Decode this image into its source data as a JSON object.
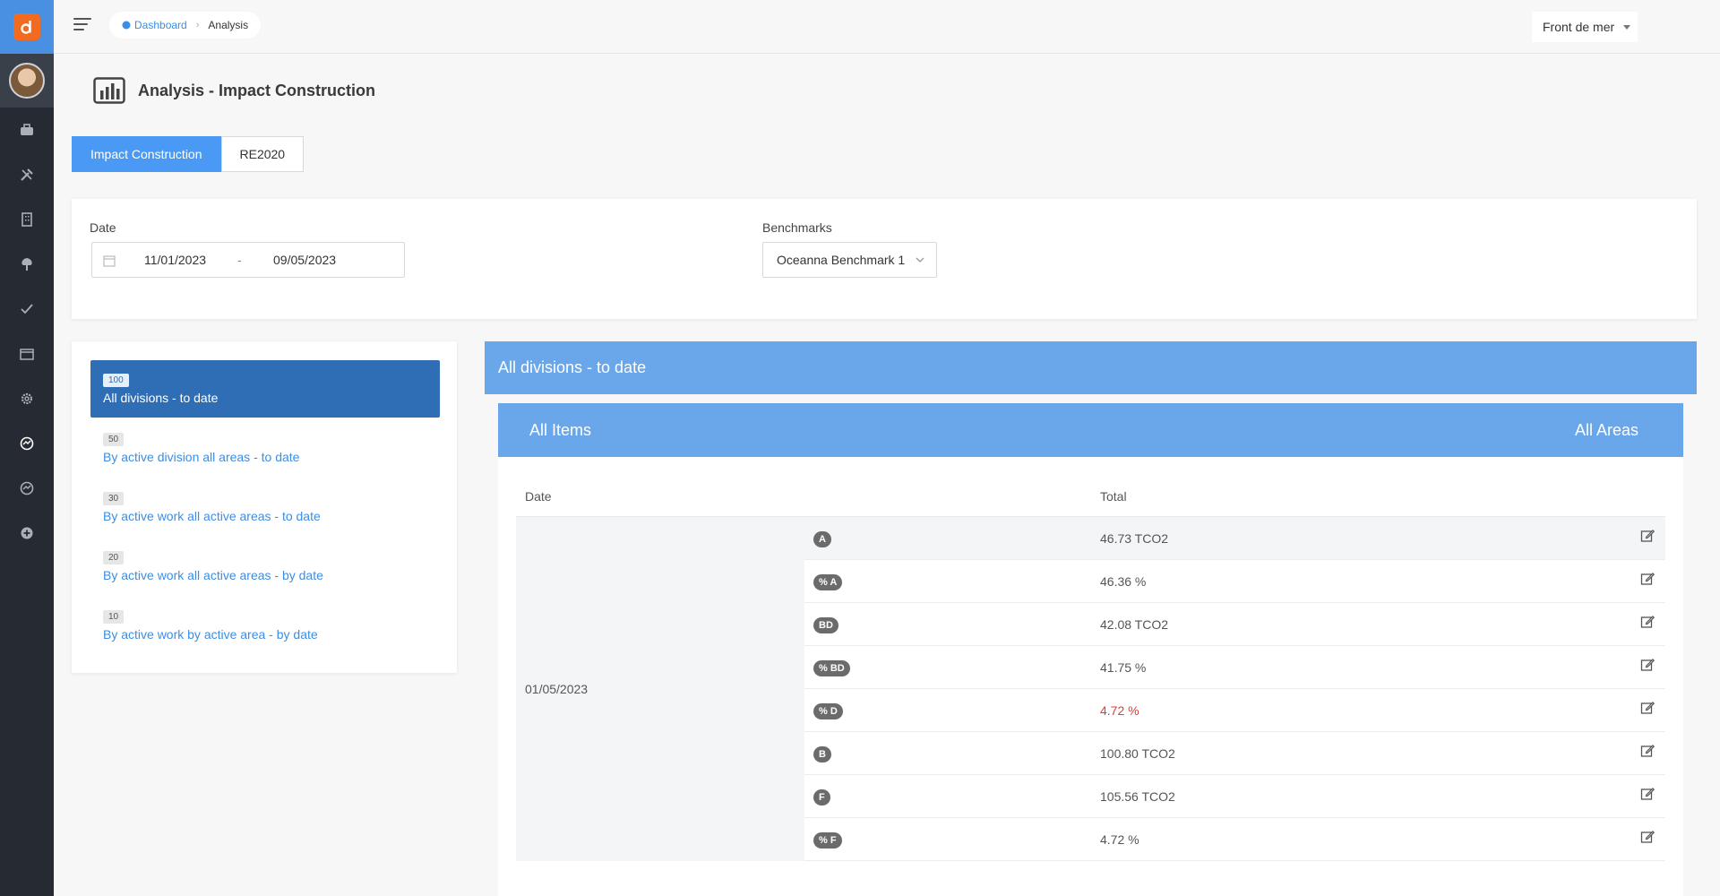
{
  "breadcrumb": {
    "home": "Dashboard",
    "current": "Analysis"
  },
  "site_select": {
    "value": "Front de mer"
  },
  "page": {
    "title": "Analysis - Impact Construction"
  },
  "tabs": [
    {
      "label": "Impact Construction",
      "active": true
    },
    {
      "label": "RE2020",
      "active": false
    }
  ],
  "filters": {
    "date_label": "Date",
    "date_from": "11/01/2023",
    "date_separator": "-",
    "date_to": "09/05/2023",
    "benchmarks_label": "Benchmarks",
    "benchmark_value": "Oceanna Benchmark 1"
  },
  "views": [
    {
      "badge": "100",
      "label": "All divisions - to date",
      "active": true
    },
    {
      "badge": "50",
      "label": "By active division all areas - to date",
      "active": false
    },
    {
      "badge": "30",
      "label": "By active work all active areas - to date",
      "active": false
    },
    {
      "badge": "20",
      "label": "By active work all active areas - by date",
      "active": false
    },
    {
      "badge": "10",
      "label": "By active work by active area - by date",
      "active": false
    }
  ],
  "panel": {
    "title": "All divisions - to date",
    "sub_left": "All Items",
    "sub_right": "All Areas"
  },
  "table": {
    "headers": {
      "date": "Date",
      "total": "Total"
    },
    "date": "01/05/2023",
    "rows": [
      {
        "tag": "A",
        "value": "46.73 TCO2"
      },
      {
        "tag": "% A",
        "value": "46.36 %"
      },
      {
        "tag": "BD",
        "value": "42.08 TCO2"
      },
      {
        "tag": "% BD",
        "value": "41.75 %"
      },
      {
        "tag": "% D",
        "value": "4.72 %",
        "color": "#e53935"
      },
      {
        "tag": "B",
        "value": "100.80 TCO2"
      },
      {
        "tag": "F",
        "value": "105.56 TCO2"
      },
      {
        "tag": "% F",
        "value": "4.72 %"
      }
    ]
  },
  "sidebar_icons": [
    "toolbox-icon",
    "tools-icon",
    "building-icon",
    "tree-icon",
    "check-icon",
    "folder-icon",
    "gear-icon",
    "analytics-icon",
    "chart-globe-icon",
    "add-icon"
  ]
}
